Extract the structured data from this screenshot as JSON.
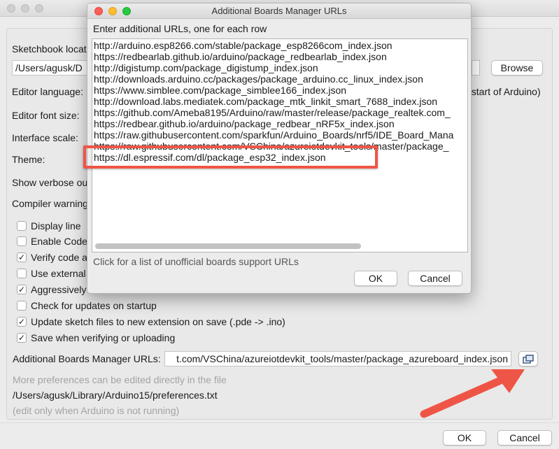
{
  "dialog": {
    "title": "Additional Boards Manager URLs",
    "instruction": "Enter additional URLs, one for each row",
    "urls": [
      "http://arduino.esp8266.com/stable/package_esp8266com_index.json",
      "https://redbearlab.github.io/arduino/package_redbearlab_index.json",
      "http://digistump.com/package_digistump_index.json",
      "http://downloads.arduino.cc/packages/package_arduino.cc_linux_index.json",
      "https://www.simblee.com/package_simblee166_index.json",
      "http://download.labs.mediatek.com/package_mtk_linkit_smart_7688_index.json",
      "https://github.com/Ameba8195/Arduino/raw/master/release/package_realtek.com_",
      "https://redbear.github.io/arduino/package_redbear_nRF5x_index.json",
      "https://raw.githubusercontent.com/sparkfun/Arduino_Boards/nrf5/IDE_Board_Mana",
      "https://raw.githubusercontent.com/VSChina/azureiotdevkit_tools/master/package_",
      "https://dl.espressif.com/dl/package_esp32_index.json"
    ],
    "unofficial_link": "Click for a list of unofficial boards support URLs",
    "ok_label": "OK",
    "cancel_label": "Cancel"
  },
  "prefs": {
    "sketchbook_label": "Sketchbook locat",
    "sketchbook_path": "/Users/agusk/D",
    "browse_label": "Browse",
    "editor_language_label": "Editor language:",
    "restart_note": "estart of Arduino)",
    "editor_font_label": "Editor font size:",
    "interface_scale_label": "Interface scale:",
    "theme_label": "Theme:",
    "verbose_label": "Show verbose ou",
    "compiler_warning_label": "Compiler warning",
    "checkboxes": [
      {
        "label": "Display line",
        "checked": false
      },
      {
        "label": "Enable Code",
        "checked": false
      },
      {
        "label": "Verify code a",
        "checked": true
      },
      {
        "label": "Use external",
        "checked": false
      },
      {
        "label": "Aggressively",
        "checked": true
      },
      {
        "label": "Check for updates on startup",
        "checked": false
      },
      {
        "label": "Update sketch files to new extension on save (.pde -> .ino)",
        "checked": true
      },
      {
        "label": "Save when verifying or uploading",
        "checked": true
      }
    ],
    "boards_urls_label": "Additional Boards Manager URLs:",
    "boards_urls_value": "t.com/VSChina/azureiotdevkit_tools/master/package_azureboard_index.json",
    "more_prefs_note": "More preferences can be edited directly in the file",
    "prefs_path": "/Users/agusk/Library/Arduino15/preferences.txt",
    "edit_note": "(edit only when Arduino is not running)",
    "ok_label": "OK",
    "cancel_label": "Cancel"
  },
  "colors": {
    "highlight": "#ef5546",
    "arrow": "#ef5546",
    "close": "#fe5f57",
    "minimize": "#febc2e",
    "maximize": "#28c840"
  }
}
